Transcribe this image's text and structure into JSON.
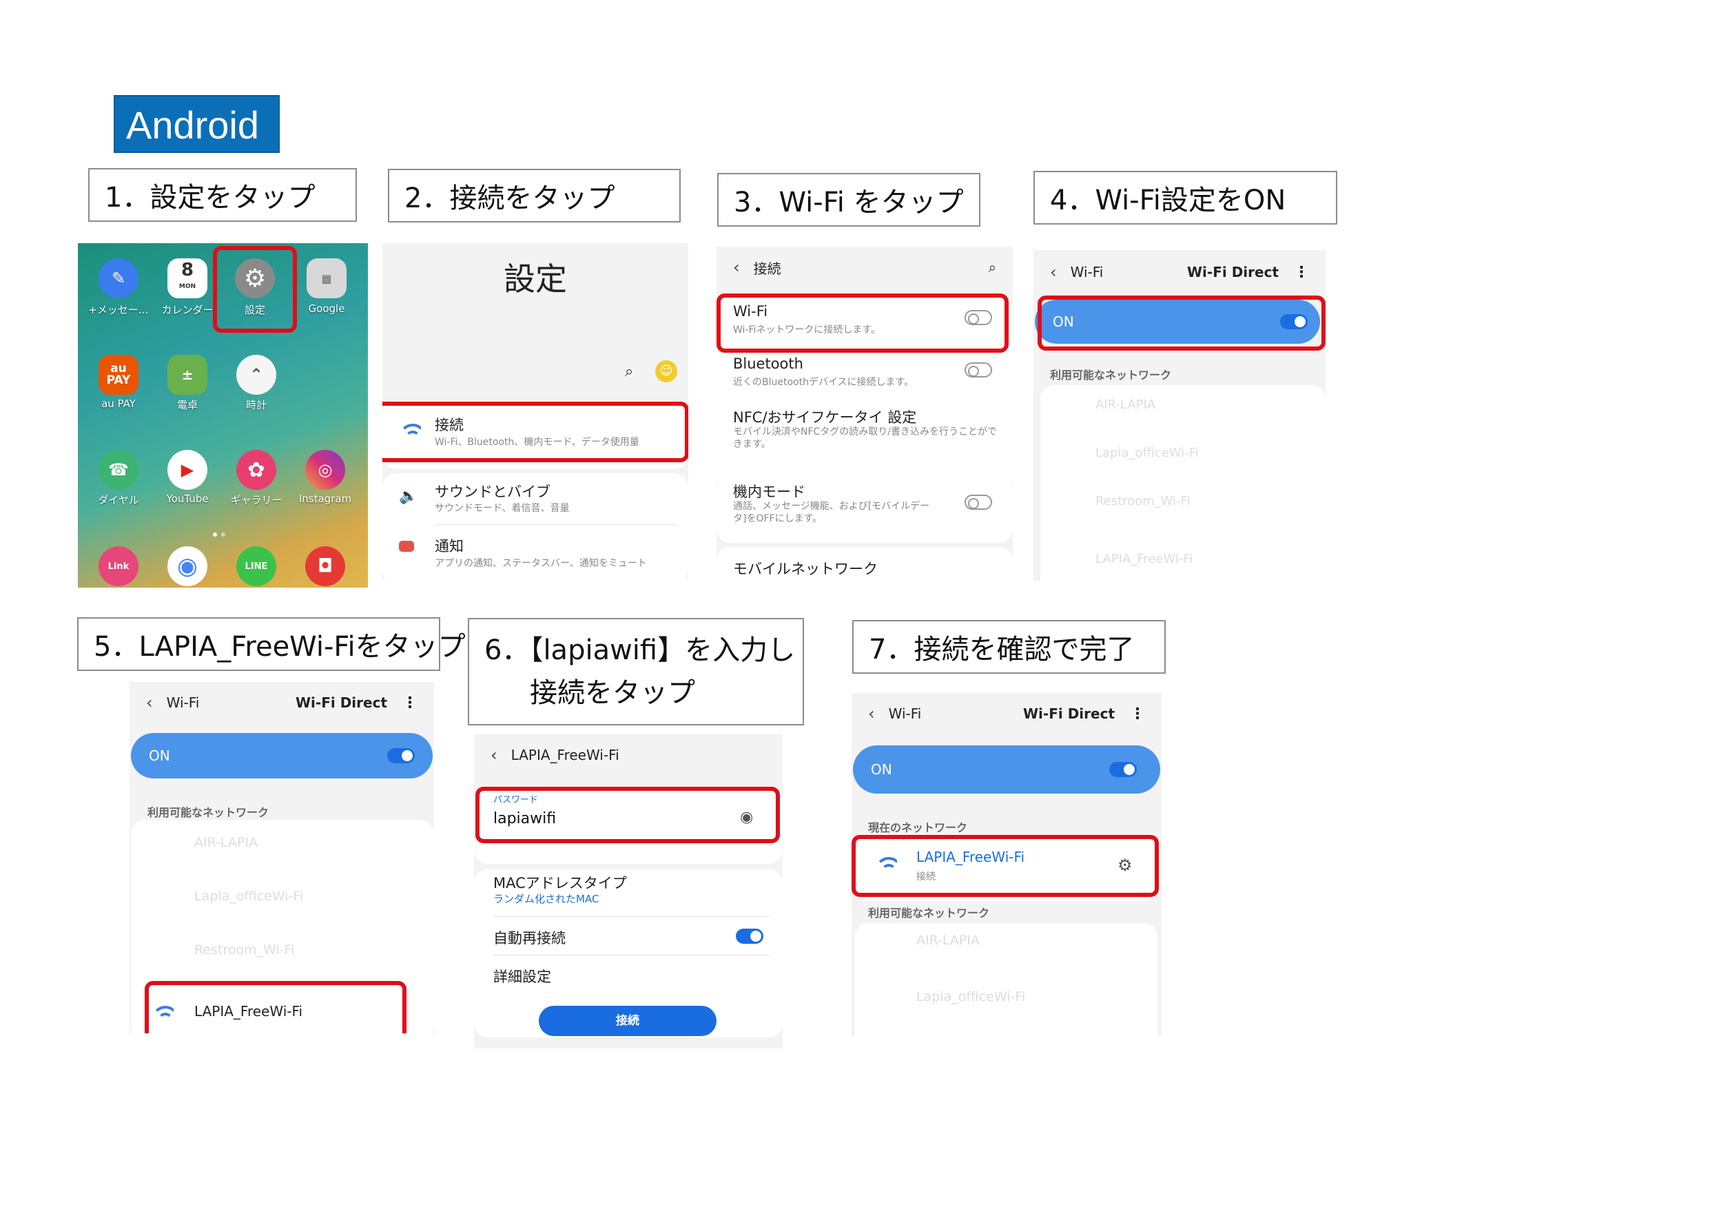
{
  "tag": "Android",
  "steps": {
    "s1": "1．設定をタップ",
    "s2": "2．接続をタップ",
    "s3": "3．Wi-Fi をタップ",
    "s4": "4．Wi-Fi設定をON",
    "s5": "5．LAPIA_FreeWi-Fiをタップ",
    "s6a": "6．【lapiawifi】を入力し",
    "s6b": "接続をタップ",
    "s7": "7．接続を確認で完了"
  },
  "home": {
    "apps": [
      {
        "label": "+メッセー…",
        "icon": "messages-icon",
        "color": "#3a7bf0"
      },
      {
        "label": "カレンダー",
        "icon": "calendar-icon",
        "color": "#ffffff",
        "day": "8",
        "weekday": "MON"
      },
      {
        "label": "設定",
        "icon": "gear-icon",
        "color": "#8a8a8a"
      },
      {
        "label": "Google",
        "icon": "google-folder-icon",
        "color": "#d8d8d8"
      },
      {
        "label": "au PAY",
        "icon": "aupay-icon",
        "color": "#ea5504",
        "text": "au\nPAY"
      },
      {
        "label": "電卓",
        "icon": "calculator-icon",
        "color": "#6ab04c"
      },
      {
        "label": "時計",
        "icon": "clock-icon",
        "color": "#f5f5f5"
      },
      {
        "label": "ダイヤル",
        "icon": "phone-icon",
        "color": "#3cb371"
      },
      {
        "label": "YouTube",
        "icon": "youtube-icon",
        "color": "#ffffff"
      },
      {
        "label": "ギャラリー",
        "icon": "gallery-icon",
        "color": "#e83e6f"
      },
      {
        "label": "Instagram",
        "icon": "instagram-icon",
        "color": "#d6307a"
      }
    ],
    "dock": [
      {
        "icon": "link-icon",
        "color": "#e8457a",
        "text": "Link"
      },
      {
        "icon": "chrome-icon",
        "color": "#ffffff"
      },
      {
        "icon": "line-icon",
        "color": "#3bc24b",
        "text": "LINE"
      },
      {
        "icon": "camera-icon",
        "color": "#e53935"
      }
    ]
  },
  "settings": {
    "title": "設定",
    "items": [
      {
        "title": "接続",
        "sub": "Wi-Fi、Bluetooth、機内モード、データ使用量"
      },
      {
        "title": "サウンドとバイブ",
        "sub": "サウンドモード、着信音、音量"
      },
      {
        "title": "通知",
        "sub": "アプリの通知、ステータスバー、通知をミュート"
      }
    ]
  },
  "connections": {
    "title": "接続",
    "items": [
      {
        "title": "Wi-Fi",
        "sub": "Wi-Fiネットワークに接続します。"
      },
      {
        "title": "Bluetooth",
        "sub": "近くのBluetoothデバイスに接続します。"
      },
      {
        "title": "NFC/おサイフケータイ 設定",
        "sub": "モバイル決済やNFCタグの読み取り/書き込みを行うことができます。"
      },
      {
        "title": "機内モード",
        "sub": "通話、メッセージ機能、および[モバイルデータ]をOFFにします。"
      },
      {
        "title": "モバイルネットワーク",
        "sub": ""
      }
    ]
  },
  "wifi": {
    "back": "Wi-Fi",
    "direct": "Wi-Fi Direct",
    "on": "ON",
    "available": "利用可能なネットワーク",
    "current": "現在のネットワーク",
    "networks": [
      "AIR-LAPIA",
      "Lapia_officeWi-Fi",
      "Restroom_Wi-Fi",
      "LAPIA_FreeWi-Fi"
    ],
    "connected_status": "接続"
  },
  "password": {
    "title": "LAPIA_FreeWi-Fi",
    "label": "パスワード",
    "value": "lapiawifi",
    "mac_title": "MACアドレスタイプ",
    "mac_value": "ランダム化されたMAC",
    "auto": "自動再接続",
    "detail": "詳細設定",
    "connect": "接続"
  },
  "colors": {
    "accent": "#0b6fb8",
    "highlight": "#e10d17",
    "toggle_bar": "#4a94ea",
    "button": "#1a6de0"
  }
}
